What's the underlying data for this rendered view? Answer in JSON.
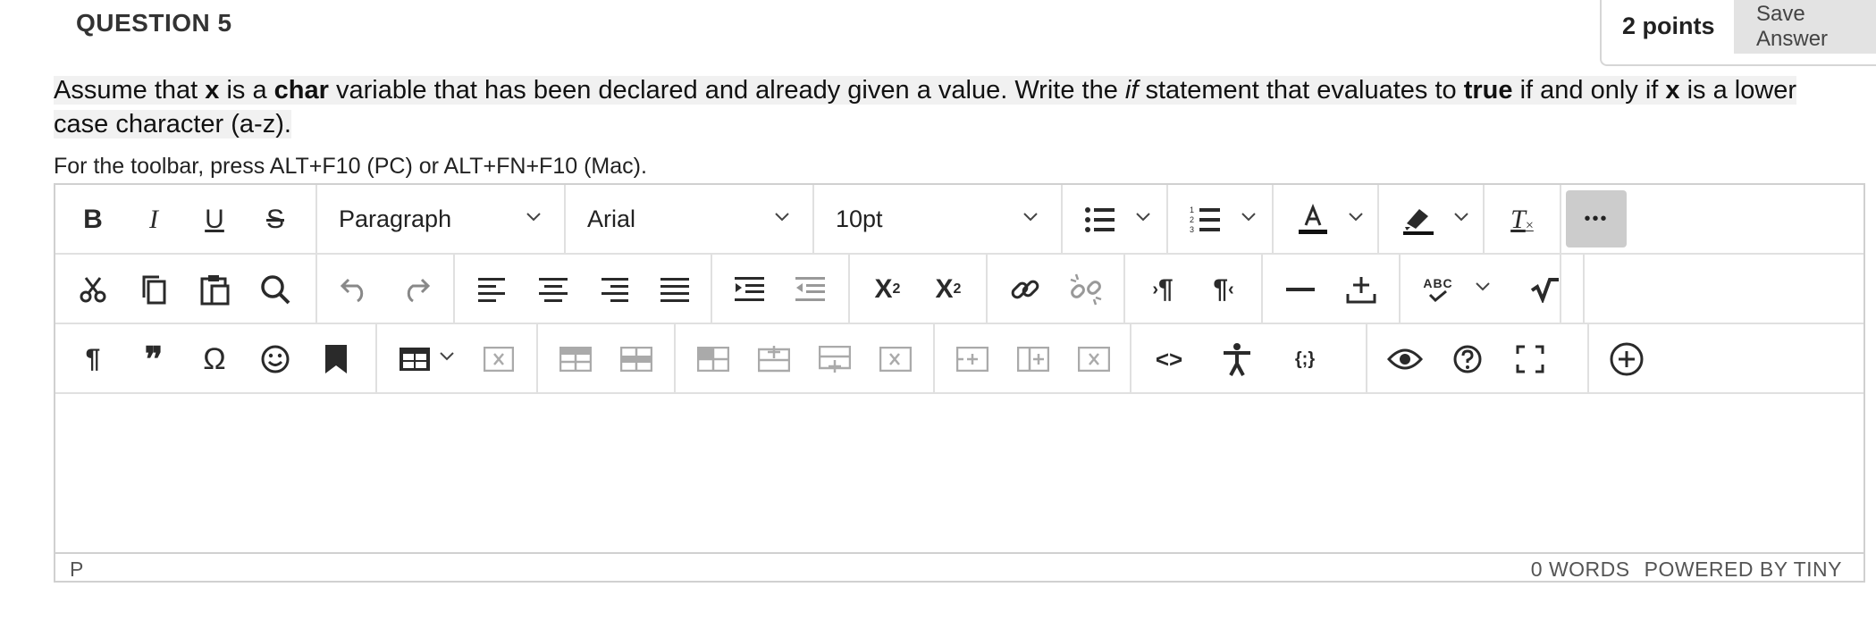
{
  "question": {
    "title": "QUESTION 5",
    "points": "2 points",
    "save_label": "Save Answer",
    "text_parts": {
      "p1": "Assume that ",
      "b1": "x",
      "p2": " is a ",
      "b2": "char",
      "p3": " variable that has been declared and already given a value. Write the ",
      "i1": "if",
      "p4": " statement that evaluates to ",
      "b3": "true",
      "p5": " if and only if ",
      "b4": "x",
      "p6": " is a lower case character (a-z). "
    },
    "toolbar_hint": "For the toolbar, press ALT+F10 (PC) or ALT+FN+F10 (Mac)."
  },
  "editor": {
    "format_select": "Paragraph",
    "font_select": "Arial",
    "size_select": "10pt",
    "text_glyphs": {
      "bold": "B",
      "italic": "I",
      "underline": "U",
      "strike": "S",
      "clear_format": "T",
      "pilcrow": "¶",
      "ltr": "¶",
      "rtl": "¶",
      "quote": "❞",
      "omega": "Ω",
      "code": "<>",
      "braces": "{;}",
      "abc": "ABC",
      "more": "•••"
    },
    "status_path": "P",
    "word_count": "0 WORDS",
    "powered_by": "POWERED BY TINY"
  },
  "colors": {
    "toolbar_border": "#e0e0e0",
    "more_button_bg": "#cccccc",
    "save_button_bg": "#e3e3e3",
    "highlight_bg": "#f1f1f1"
  }
}
